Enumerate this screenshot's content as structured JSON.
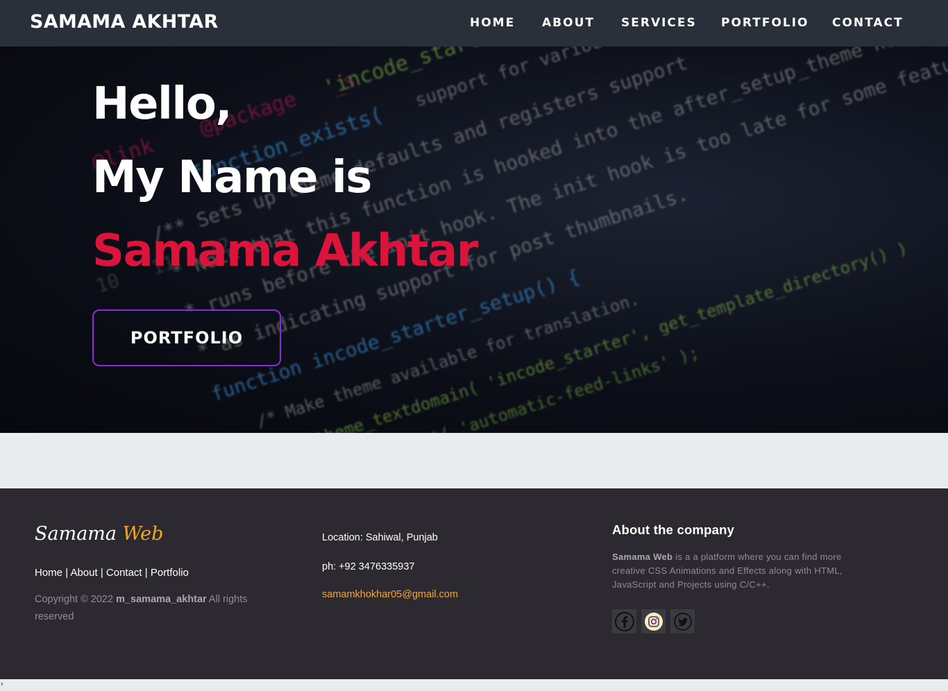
{
  "navbar": {
    "brand": "SAMAMA AKHTAR",
    "links": [
      "HOME",
      "ABOUT",
      "SERVICES",
      "PORTFOLIO",
      "CONTACT"
    ]
  },
  "hero": {
    "line1": "Hello,",
    "line2": "My Name is",
    "line3": "Samama Akhtar",
    "button_label": "PORTFOLIO"
  },
  "footer": {
    "logo_main": "Samama",
    "logo_accent": "Web",
    "links": [
      "Home",
      "About",
      "Contact",
      "Portfolio"
    ],
    "link_separator": "|",
    "copyright_prefix": "Copyright © 2022",
    "copyright_name": "m_samama_akhtar",
    "copyright_suffix": "All rights reserved",
    "location": "Location: Sahiwal, Punjab",
    "phone": "ph: +92 3476335937",
    "email": "samamkhokhar05@gmail.com",
    "about_title": "About the company",
    "about_company": "Samama Web",
    "about_text": "is a a platform where you can find more creative CSS Animations and Effects along with HTML, JavaScript and Projects using C/C++.",
    "social_icons": [
      "facebook-icon",
      "instagram-icon",
      "twitter-icon"
    ]
  },
  "bottom_mark": "›",
  "colors": {
    "navbar_bg": "#2a303a",
    "accent_red": "#dc143c",
    "button_border": "#8a2be2",
    "footer_bg": "#2c2a30",
    "footer_accent": "#f5a623",
    "page_bg": "#e8ecef"
  }
}
